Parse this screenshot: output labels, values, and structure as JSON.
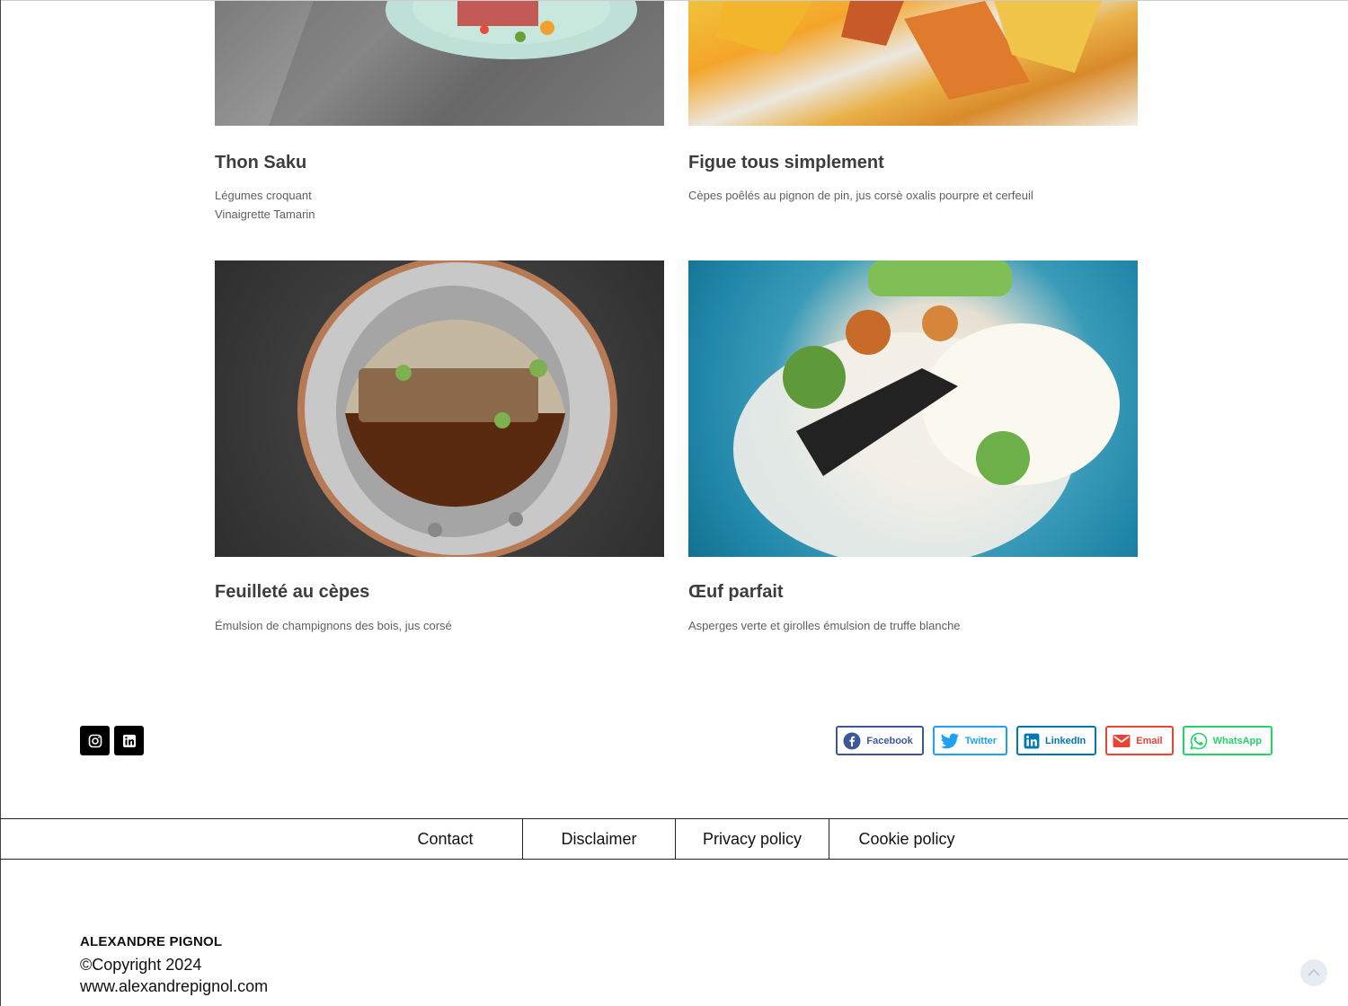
{
  "dishes": [
    {
      "title": "Thon Saku",
      "desc_lines": [
        "Légumes croquant",
        "Vinaigrette Tamarin"
      ]
    },
    {
      "title": "Figue tous simplement",
      "desc_lines": [
        "Cèpes poêlés au pignon de pin, jus corsè oxalis pourpre et cerfeuil"
      ]
    },
    {
      "title": "Feuilleté au cèpes",
      "desc_lines": [
        "Émulsion de champignons des bois, jus corsé"
      ]
    },
    {
      "title": "Œuf parfait",
      "desc_lines": [
        "Asperges verte et girolles émulsion de truffe blanche"
      ]
    }
  ],
  "share": {
    "facebook": "Facebook",
    "twitter": "Twitter",
    "linkedin": "LinkedIn",
    "email": "Email",
    "whatsapp": "WhatsApp"
  },
  "share_colors": {
    "facebook": "#3b5998",
    "twitter": "#1da1f2",
    "linkedin": "#0077b5",
    "email": "#ea4335",
    "whatsapp": "#25d366"
  },
  "social_icons": [
    "instagram-icon",
    "linkedin-icon"
  ],
  "footer_nav": [
    "Contact",
    "Disclaimer",
    "Privacy policy",
    "Cookie policy"
  ],
  "footer": {
    "name": "ALEXANDRE PIGNOL",
    "copyright": "©Copyright 2024",
    "website": "www.alexandrepignol.com"
  }
}
